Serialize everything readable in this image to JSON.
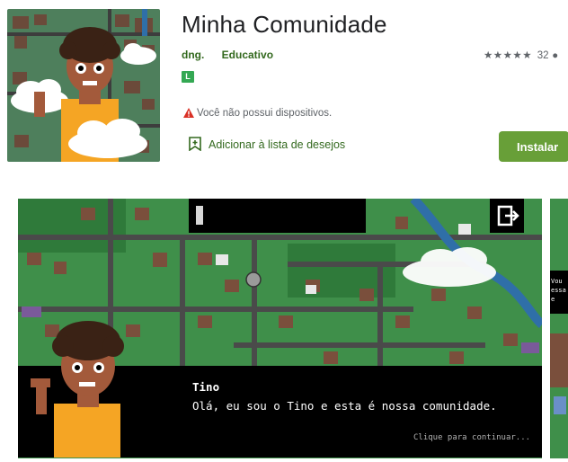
{
  "app": {
    "title": "Minha Comunidade",
    "developer": "dng.",
    "category": "Educativo",
    "rating_stars": "★★★★★",
    "rating_count": "32",
    "content_rating": "L",
    "warning_text": "Você não possui dispositivos.",
    "wishlist_label": "Adicionar à lista de desejos",
    "install_label": "Instalar"
  },
  "screenshot": {
    "character_name": "Tino",
    "dialog_text": "Olá, eu sou o Tino e esta é nossa comunidade.",
    "continue_hint": "Clique para continuar...",
    "next_preview_text": "Vou\nessa\ne"
  },
  "colors": {
    "accent": "#689f38",
    "accent_text": "#33691e",
    "badge": "#34a853",
    "warning": "#d93025"
  }
}
